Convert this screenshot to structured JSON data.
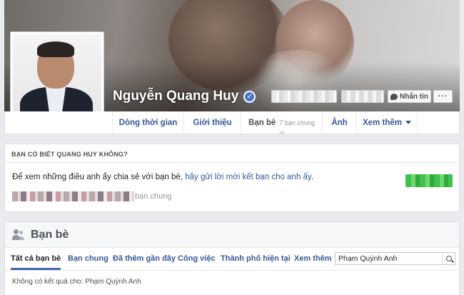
{
  "profile": {
    "name": "Nguyễn Quang Huy",
    "verified_icon": "✓",
    "message_label": "Nhắn tin",
    "more_label": "···"
  },
  "nav": {
    "items": [
      {
        "label": "Dòng thời gian"
      },
      {
        "label": "Giới thiệu"
      },
      {
        "label": "Bạn bè",
        "sub": "7 bạn chung"
      },
      {
        "label": "Ảnh"
      },
      {
        "label": "Xem thêm"
      }
    ]
  },
  "know_card": {
    "header": "BẠN CÓ BIẾT QUANG HUY KHÔNG?",
    "text": "Để xem những điều anh ấy chia sẻ với bạn bè, ",
    "link": "hãy gửi lời mời kết bạn cho anh ấy",
    "text_end": ".",
    "mutual_label": "bạn chung"
  },
  "friends": {
    "title": "Bạn bè",
    "tabs": [
      {
        "label": "Tất cả bạn bè"
      },
      {
        "label": "Bạn chung"
      },
      {
        "label": "Đã thêm gần đây"
      },
      {
        "label": "Công việc"
      },
      {
        "label": "Thành phố hiện tại"
      },
      {
        "label": "Xem thêm"
      }
    ],
    "search_value": "Phạm Quỳnh Anh",
    "no_results": "Không có kết quả cho: Phạm Quỳnh Anh"
  },
  "colors": {
    "link": "#365899",
    "background": "#e9ebee",
    "verified": "#4a76ce",
    "accent": "#4267b2"
  },
  "icons": [
    "verified-icon",
    "messenger-icon",
    "caret-icon",
    "friends-icon",
    "search-icon"
  ]
}
